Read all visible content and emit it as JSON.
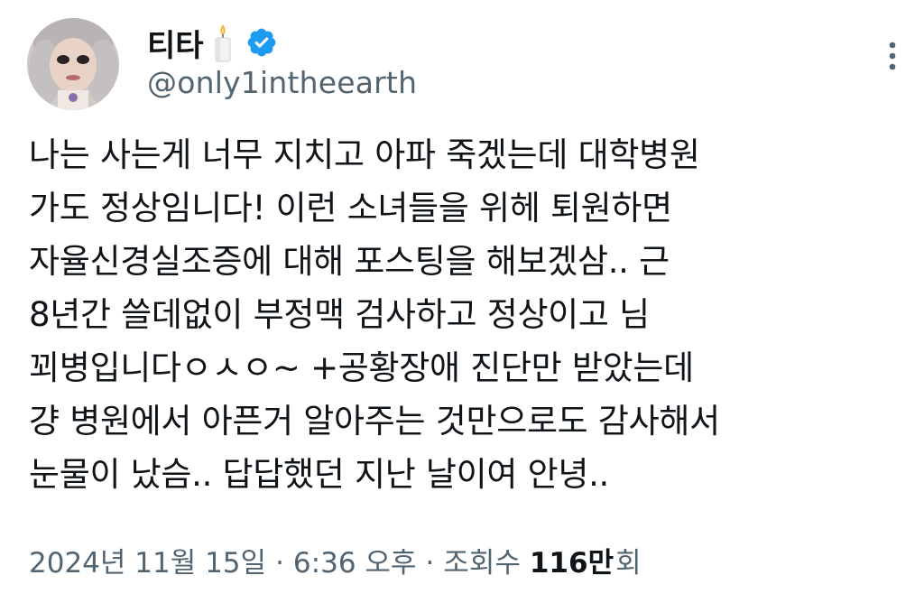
{
  "author": {
    "display_name": "티타",
    "name_emoji_icon": "candle-icon",
    "verified_icon": "verified-badge-icon",
    "handle": "@only1intheearth"
  },
  "tweet": {
    "lines": [
      "나는 사는게 너무 지치고 아파 죽겠는데 대학병원",
      "가도 정상임니다! 이런 소녀들을 위헤 퇴원하면",
      "자율신경실조증에 대해 포스팅을 해보겠삼.. 근",
      "8년간 쓸데없이 부정맥 검사하고 정상이고 님",
      "꾀병입니다ㅇㅅㅇ~ +공황장애 진단만 받았는데",
      "걍 병원에서 아픈거 알아주는 것만으로도 감사해서",
      "눈물이 났슴.. 답답했던 지난 날이여 안녕.."
    ]
  },
  "meta": {
    "date": "2024년 11월 15일",
    "time": "6:36 오후",
    "views_label": "조회수",
    "views_count": "116만",
    "views_suffix": "회",
    "separator": "·"
  },
  "colors": {
    "text": "#0f1419",
    "secondary": "#536471",
    "verified": "#1d9bf0"
  }
}
